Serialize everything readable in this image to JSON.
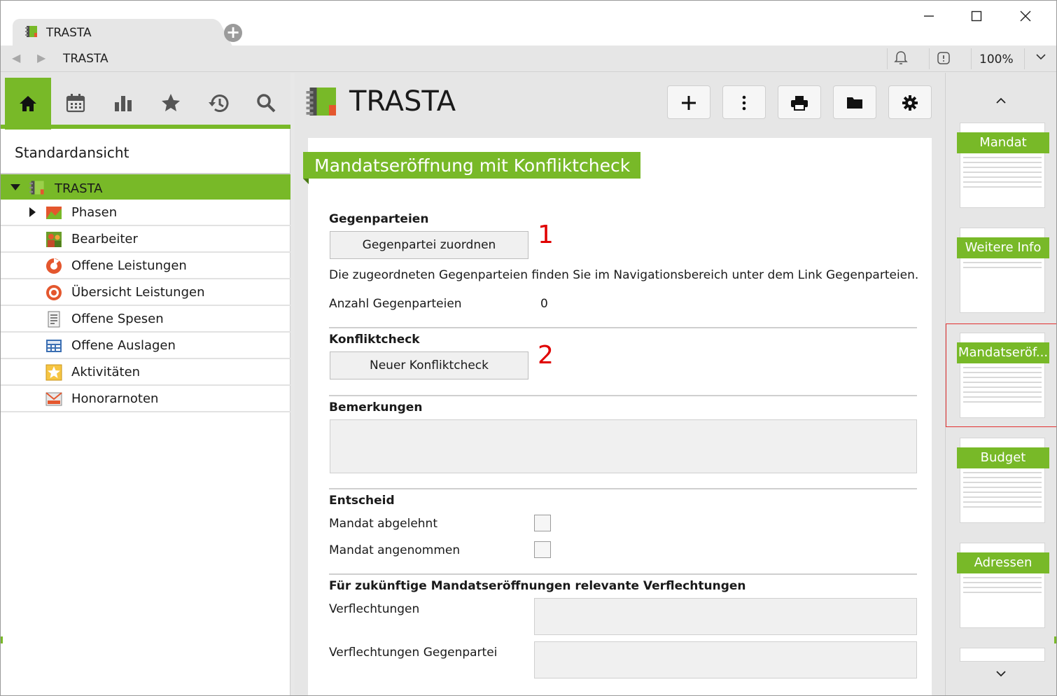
{
  "window": {
    "tab_title": "TRASTA",
    "address": "TRASTA",
    "zoom": "100%"
  },
  "icons": {
    "new_tab": "plus-circle-icon",
    "minimize": "minimize-icon",
    "maximize": "maximize-icon",
    "close": "close-icon",
    "back": "back-arrow-icon",
    "forward": "forward-arrow-icon",
    "bell": "bell-icon",
    "alert": "alert-icon",
    "zoom_menu": "chevron-down-icon"
  },
  "sidebar": {
    "tools": [
      "home-icon",
      "calendar-icon",
      "bar-chart-icon",
      "star-icon",
      "history-icon",
      "search-icon"
    ],
    "view_title": "Standardansicht",
    "root": "TRASTA",
    "items": [
      {
        "label": "Phasen",
        "icon": "phases-icon",
        "expandable": true
      },
      {
        "label": "Bearbeiter",
        "icon": "people-icon",
        "expandable": false
      },
      {
        "label": "Offene Leistungen",
        "icon": "clock-icon",
        "expandable": false
      },
      {
        "label": "Übersicht Leistungen",
        "icon": "target-icon",
        "expandable": false
      },
      {
        "label": "Offene Spesen",
        "icon": "receipt-icon",
        "expandable": false
      },
      {
        "label": "Offene Auslagen",
        "icon": "calculator-icon",
        "expandable": false
      },
      {
        "label": "Aktivitäten",
        "icon": "star-icon",
        "expandable": false
      },
      {
        "label": "Honorarnoten",
        "icon": "invoice-icon",
        "expandable": false
      }
    ]
  },
  "main": {
    "title": "TRASTA",
    "toolbar": [
      "plus-icon",
      "more-vertical-icon",
      "print-icon",
      "folder-icon",
      "gear-icon"
    ],
    "section_title": "Mandatseröffnung mit Konfliktcheck",
    "gegenparteien": {
      "heading": "Gegenparteien",
      "button": "Gegenpartei zuordnen",
      "marker": "1",
      "info": "Die zugeordneten Gegenparteien finden Sie im Navigationsbereich unter dem Link Gegenparteien.",
      "count_label": "Anzahl Gegenparteien",
      "count_value": "0"
    },
    "konfliktcheck": {
      "heading": "Konfliktcheck",
      "button": "Neuer Konfliktcheck",
      "marker": "2"
    },
    "bemerkungen": {
      "heading": "Bemerkungen",
      "value": ""
    },
    "entscheid": {
      "heading": "Entscheid",
      "abgelehnt_label": "Mandat abgelehnt",
      "abgelehnt_checked": false,
      "angenommen_label": "Mandat angenommen",
      "angenommen_checked": false
    },
    "verflechtungen": {
      "heading": "Für zukünftige Mandatseröffnungen relevante Verflechtungen",
      "verflechtungen_label": "Verflechtungen",
      "verflechtungen_value": "",
      "gegenpartei_label": "Verflechtungen Gegenpartei",
      "gegenpartei_value": ""
    }
  },
  "thumbnails": [
    {
      "label": "Mandat",
      "selected": false
    },
    {
      "label": "Weitere Info",
      "selected": false
    },
    {
      "label": "Mandatseröf...",
      "selected": true
    },
    {
      "label": "Budget",
      "selected": false
    },
    {
      "label": "Adressen",
      "selected": false
    }
  ],
  "colors": {
    "accent": "#78b928",
    "marker": "#e00000",
    "selection": "#e23030"
  }
}
